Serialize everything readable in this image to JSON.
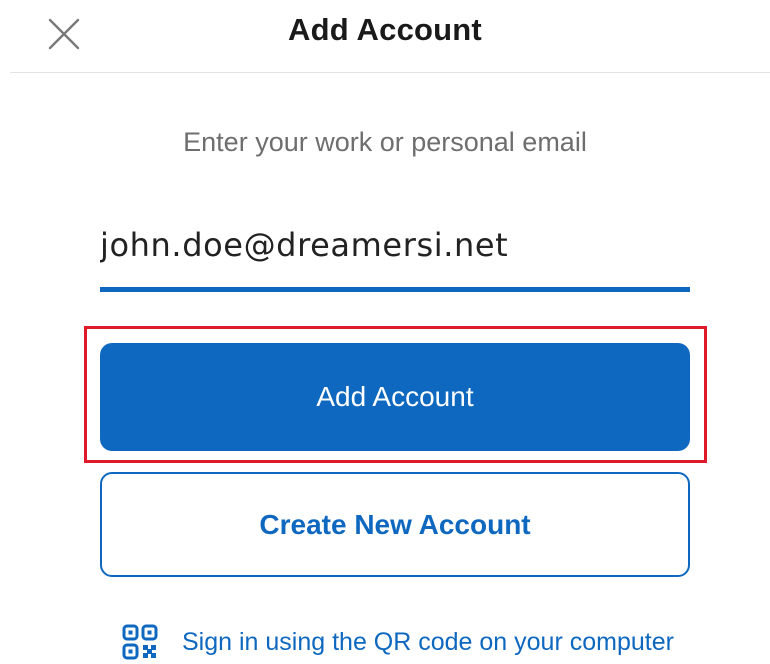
{
  "header": {
    "title": "Add Account",
    "close_icon": "close-icon"
  },
  "form": {
    "prompt": "Enter your work or personal email",
    "email_value": "john.doe@dreamersi.net"
  },
  "buttons": {
    "add_account_label": "Add Account",
    "create_account_label": "Create New Account"
  },
  "qr": {
    "icon": "qr-code-icon",
    "label": "Sign in using the QR code on your computer"
  },
  "colors": {
    "accent": "#0f68bf",
    "highlight": "#e0192a"
  }
}
